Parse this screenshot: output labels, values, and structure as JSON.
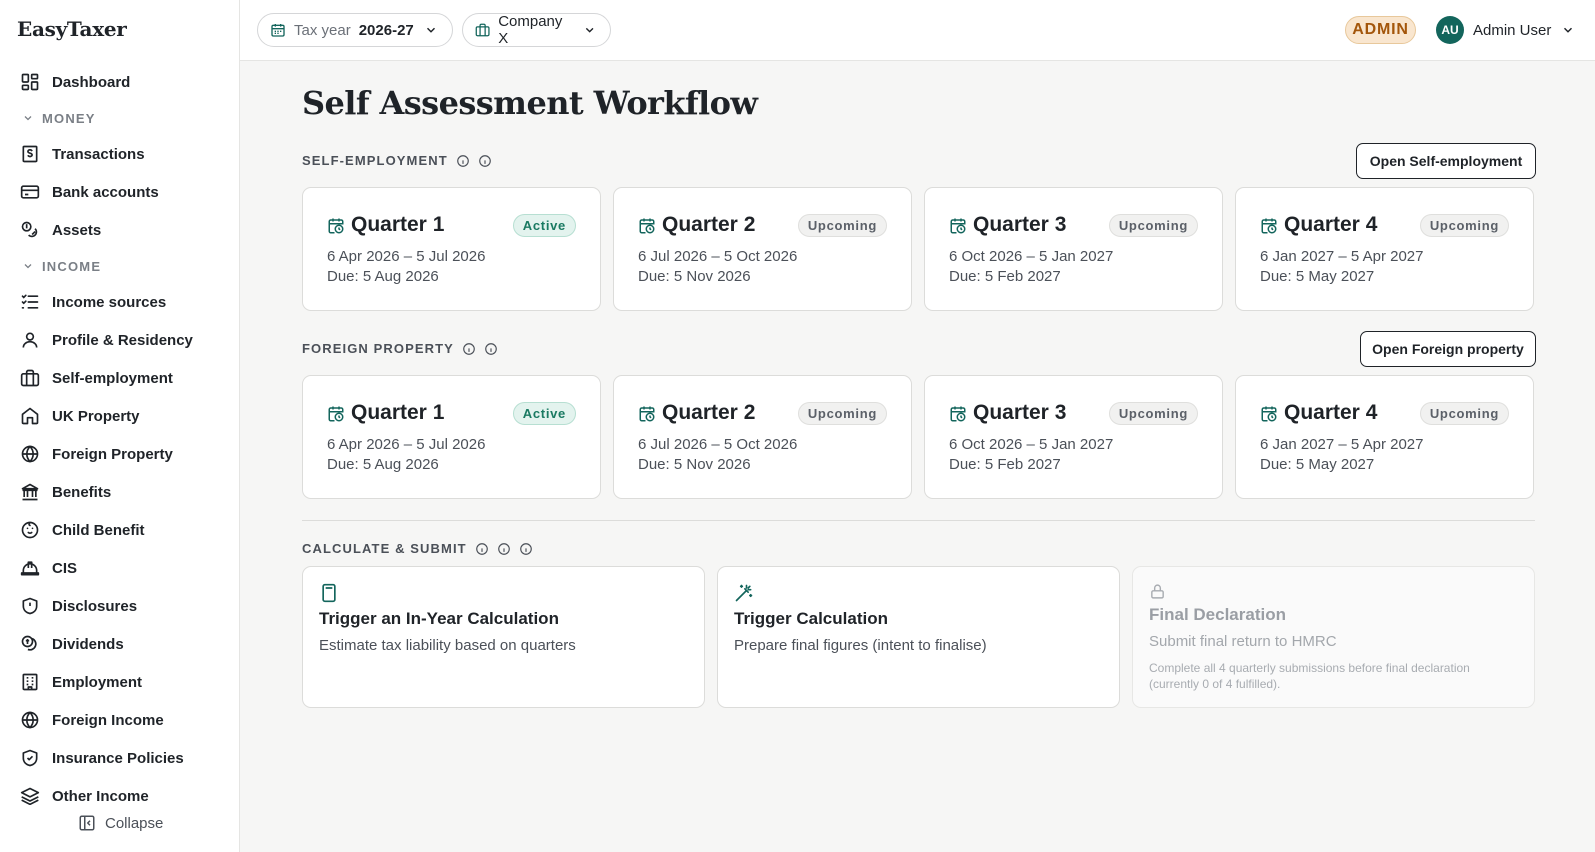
{
  "app": {
    "logo": "EasyTaxer"
  },
  "sidebar": {
    "items": [
      {
        "type": "item",
        "label": "Dashboard",
        "icon": "dashboard-icon"
      },
      {
        "type": "section",
        "label": "MONEY"
      },
      {
        "type": "item",
        "label": "Transactions",
        "icon": "receipt-icon"
      },
      {
        "type": "item",
        "label": "Bank accounts",
        "icon": "bank-card-icon"
      },
      {
        "type": "item",
        "label": "Assets",
        "icon": "coins-icon"
      },
      {
        "type": "section",
        "label": "INCOME"
      },
      {
        "type": "item",
        "label": "Income sources",
        "icon": "list-check-icon"
      },
      {
        "type": "item",
        "label": "Profile & Residency",
        "icon": "user-icon"
      },
      {
        "type": "item",
        "label": "Self-employment",
        "icon": "briefcase-icon"
      },
      {
        "type": "item",
        "label": "UK Property",
        "icon": "house-icon"
      },
      {
        "type": "item",
        "label": "Foreign Property",
        "icon": "globe-icon"
      },
      {
        "type": "item",
        "label": "Benefits",
        "icon": "landmark-icon"
      },
      {
        "type": "item",
        "label": "Child Benefit",
        "icon": "baby-icon"
      },
      {
        "type": "item",
        "label": "CIS",
        "icon": "hard-hat-icon"
      },
      {
        "type": "item",
        "label": "Disclosures",
        "icon": "shield-icon"
      },
      {
        "type": "item",
        "label": "Dividends",
        "icon": "coins-stack-icon"
      },
      {
        "type": "item",
        "label": "Employment",
        "icon": "building-icon"
      },
      {
        "type": "item",
        "label": "Foreign Income",
        "icon": "globe-icon"
      },
      {
        "type": "item",
        "label": "Insurance Policies",
        "icon": "shield-check-icon"
      },
      {
        "type": "item",
        "label": "Other Income",
        "icon": "layers-icon"
      }
    ],
    "collapse_label": "Collapse"
  },
  "topbar": {
    "tax_year_label": "Tax year",
    "tax_year_value": "2026-27",
    "company": "Company X",
    "role_badge": "ADMIN",
    "user_initials": "AU",
    "user_name": "Admin User"
  },
  "page": {
    "title": "Self Assessment Workflow"
  },
  "self_employment": {
    "label": "SELF-EMPLOYMENT",
    "open_button": "Open Self-employment",
    "quarters": [
      {
        "title": "Quarter 1",
        "status": "Active",
        "period": "6 Apr 2026 – 5 Jul 2026",
        "due": "Due: 5 Aug 2026"
      },
      {
        "title": "Quarter 2",
        "status": "Upcoming",
        "period": "6 Jul 2026 – 5 Oct 2026",
        "due": "Due: 5 Nov 2026"
      },
      {
        "title": "Quarter 3",
        "status": "Upcoming",
        "period": "6 Oct 2026 – 5 Jan 2027",
        "due": "Due: 5 Feb 2027"
      },
      {
        "title": "Quarter 4",
        "status": "Upcoming",
        "period": "6 Jan 2027 – 5 Apr 2027",
        "due": "Due: 5 May 2027"
      }
    ]
  },
  "foreign_property": {
    "label": "FOREIGN PROPERTY",
    "open_button": "Open Foreign property",
    "quarters": [
      {
        "title": "Quarter 1",
        "status": "Active",
        "period": "6 Apr 2026 – 5 Jul 2026",
        "due": "Due: 5 Aug 2026"
      },
      {
        "title": "Quarter 2",
        "status": "Upcoming",
        "period": "6 Jul 2026 – 5 Oct 2026",
        "due": "Due: 5 Nov 2026"
      },
      {
        "title": "Quarter 3",
        "status": "Upcoming",
        "period": "6 Oct 2026 – 5 Jan 2027",
        "due": "Due: 5 Feb 2027"
      },
      {
        "title": "Quarter 4",
        "status": "Upcoming",
        "period": "6 Jan 2027 – 5 Apr 2027",
        "due": "Due: 5 May 2027"
      }
    ]
  },
  "calculate": {
    "label": "CALCULATE & SUBMIT",
    "cards": [
      {
        "title": "Trigger an In-Year Calculation",
        "description": "Estimate tax liability based on quarters",
        "icon": "calculator-icon"
      },
      {
        "title": "Trigger Calculation",
        "description": "Prepare final figures (intent to finalise)",
        "icon": "wand-icon"
      },
      {
        "title": "Final Declaration",
        "description": "Submit final return to HMRC",
        "icon": "lock-icon",
        "note": "Complete all 4 quarterly submissions before final declaration (currently 0 of 4 fulfilled)."
      }
    ]
  },
  "colors": {
    "accent": "#13655c",
    "admin_badge_bg": "#f9e6cf",
    "admin_badge_text": "#a3560b",
    "active_badge": "#1a7a62"
  }
}
